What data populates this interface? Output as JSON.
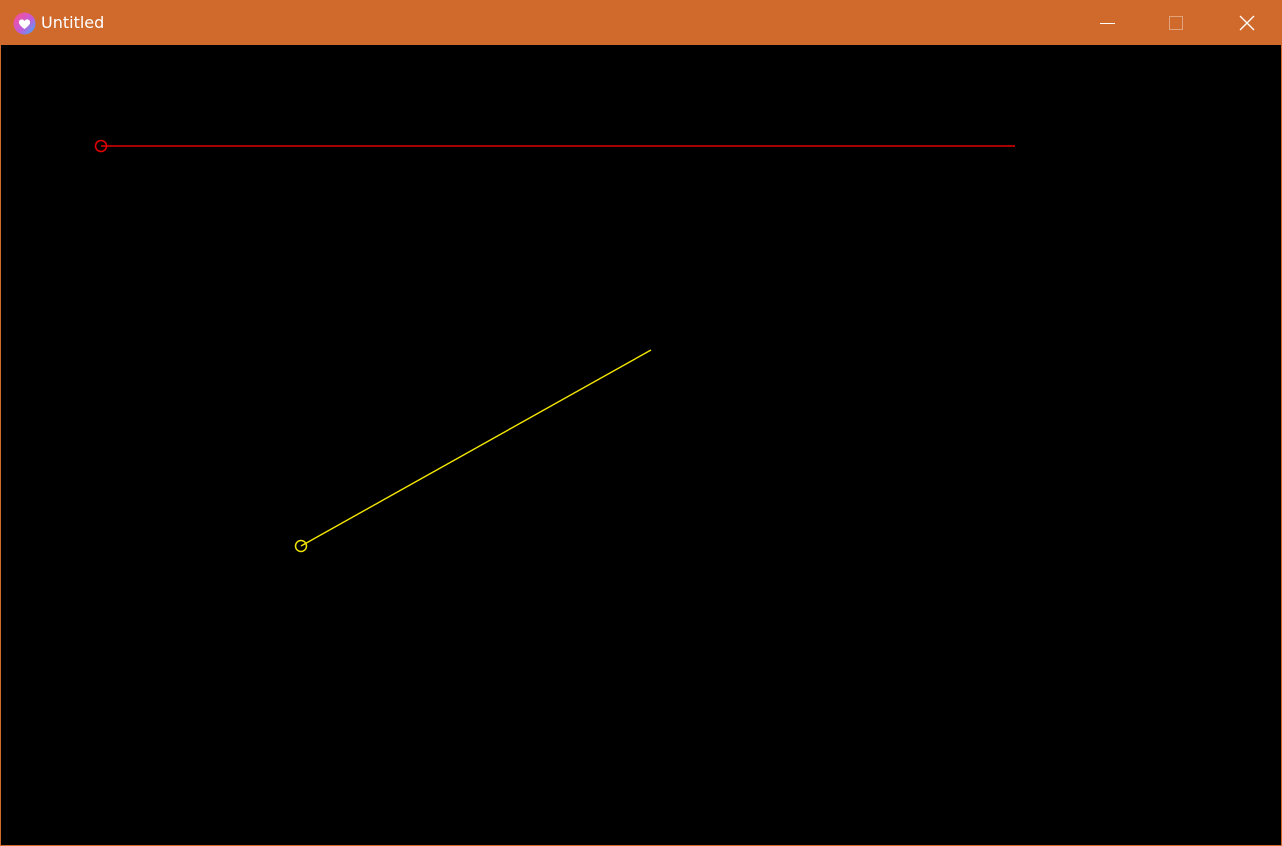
{
  "window": {
    "title": "Untitled",
    "titlebar_color": "#cf692c",
    "app_icon": "heart-app-icon"
  },
  "controls": {
    "minimize_icon": "minimize-icon",
    "maximize_icon": "maximize-icon",
    "close_icon": "close-icon",
    "maximize_enabled": false
  },
  "canvas": {
    "background": "#000000",
    "items": [
      {
        "kind": "line-with-start-handle",
        "color": "#e00000"
      },
      {
        "kind": "line-with-start-handle",
        "color": "#f2e600"
      }
    ]
  }
}
